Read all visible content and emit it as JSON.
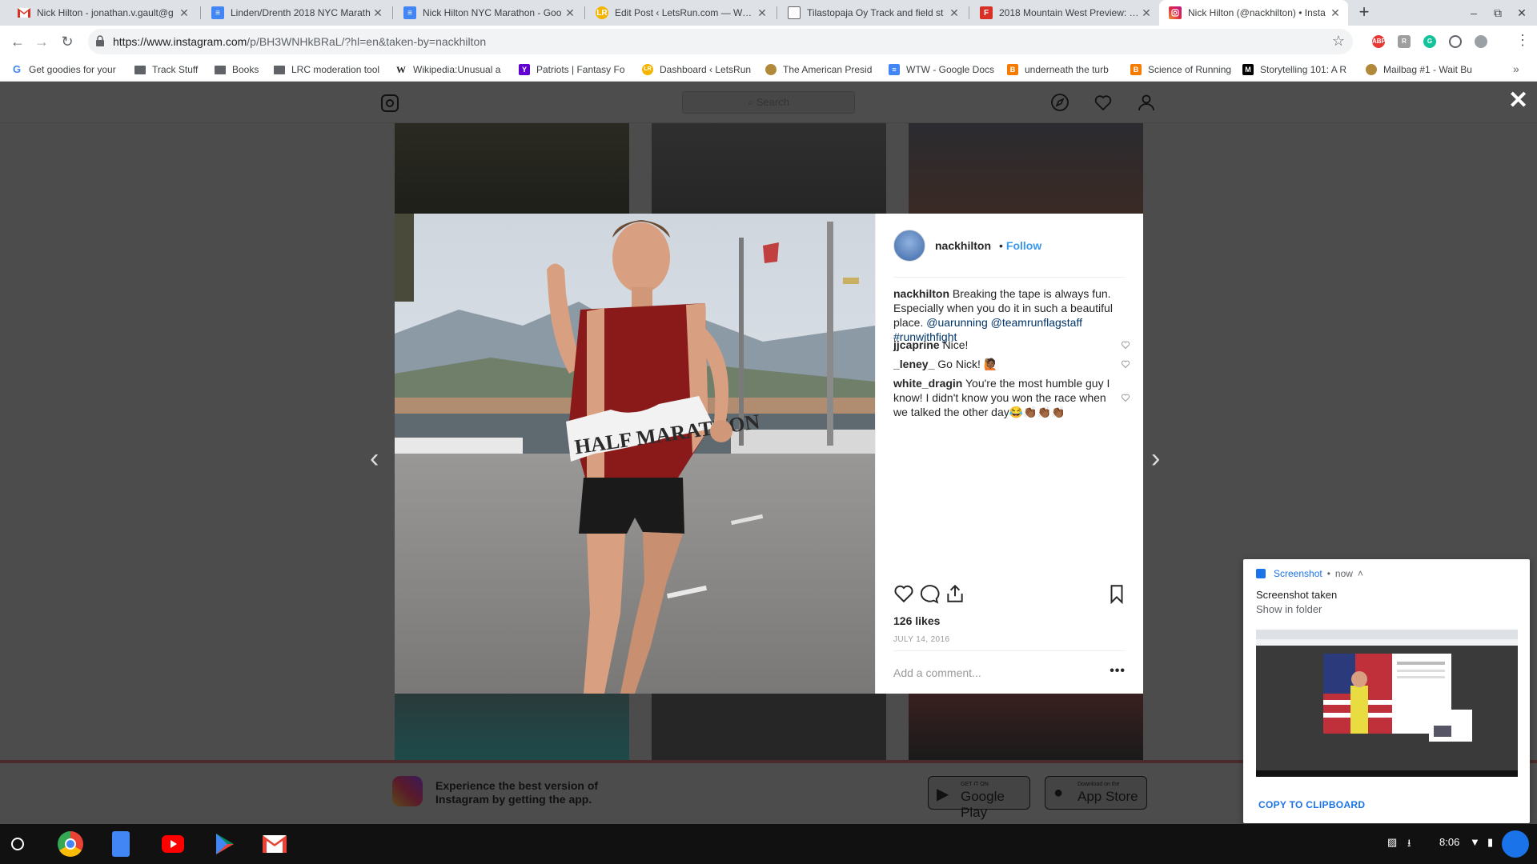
{
  "browser": {
    "tabs": [
      {
        "title": "Nick Hilton - jonathan.v.gault@g",
        "favicon": "gmail",
        "color": "#d93025"
      },
      {
        "title": "Linden/Drenth 2018 NYC Marath",
        "favicon": "docs",
        "color": "#4285f4"
      },
      {
        "title": "Nick Hilton NYC Marathon - Goo",
        "favicon": "docs",
        "color": "#4285f4"
      },
      {
        "title": "Edit Post ‹ LetsRun.com — Word",
        "favicon": "letsrun",
        "color": "#f4b400"
      },
      {
        "title": "Tilastopaja Oy Track and field st",
        "favicon": "page",
        "color": "#9aa0a6"
      },
      {
        "title": "2018 Mountain West Preview: Bo",
        "favicon": "flotrack",
        "color": "#d93025"
      },
      {
        "title": "Nick Hilton (@nackhilton) • Insta",
        "favicon": "instagram",
        "color": "#c13584",
        "active": true
      }
    ],
    "url_main": "https://www.instagram.com",
    "url_rest": "/p/BH3WNHkBRaL/?hl=en&taken-by=nackhilton",
    "bookmarks": [
      {
        "label": "Get goodies for your",
        "icon": "google",
        "color": "#4285f4"
      },
      {
        "label": "Track Stuff",
        "icon": "folder"
      },
      {
        "label": "Books",
        "icon": "folder"
      },
      {
        "label": "LRC moderation tool",
        "icon": "folder"
      },
      {
        "label": "Wikipedia:Unusual a",
        "icon": "wikipedia",
        "color": "#202124"
      },
      {
        "label": "Patriots | Fantasy Fo",
        "icon": "yahoo",
        "color": "#6001d2"
      },
      {
        "label": "Dashboard ‹ LetsRun",
        "icon": "letsrun",
        "color": "#f4b400"
      },
      {
        "label": "The American Presid",
        "icon": "seal",
        "color": "#b08a3a"
      },
      {
        "label": "WTW - Google Docs",
        "icon": "docs",
        "color": "#4285f4"
      },
      {
        "label": "underneath the turb",
        "icon": "blogger",
        "color": "#f57c00"
      },
      {
        "label": "Science of Running",
        "icon": "blogger",
        "color": "#f57c00"
      },
      {
        "label": "Storytelling 101: A R",
        "icon": "medium",
        "color": "#000000"
      },
      {
        "label": "Mailbag #1 - Wait Bu",
        "icon": "seal",
        "color": "#b08a3a"
      }
    ],
    "extensions": [
      {
        "name": "adblock-plus-icon",
        "label": "ABP",
        "color": "#e53935"
      },
      {
        "name": "extension-r-icon",
        "label": "R",
        "color": "#9e9e9e"
      },
      {
        "name": "grammarly-icon",
        "label": "G",
        "color": "#15c39a"
      },
      {
        "name": "extension-settings-icon",
        "label": "",
        "color": "#5f6368"
      },
      {
        "name": "profile-icon",
        "label": "",
        "color": "#9aa0a6"
      }
    ]
  },
  "instagram": {
    "search_placeholder": "Search",
    "post": {
      "username": "nackhilton",
      "follow_label": "Follow",
      "caption_user": "nackhilton",
      "caption_text": "Breaking the tape is always fun. Especially when you do it in such a beautiful place.",
      "caption_mentions": "@uarunning @teamrunflagstaff",
      "caption_hashtag": "#runwithfight",
      "comments": [
        {
          "user": "jjcaprine",
          "text": "Nice!"
        },
        {
          "user": "_leney_",
          "text": "Go Nick! 🙋🏾"
        },
        {
          "user": "white_dragin",
          "text": "You're the most humble guy I know! I didn't know you won the race when we talked the other day😂👏🏾👏🏾👏🏾"
        }
      ],
      "likes": "126 likes",
      "date": "JULY 14, 2016",
      "comment_placeholder": "Add a comment...",
      "more_label": "•••",
      "bib_text": "HALF MARATHON"
    },
    "app_banner": {
      "text": "Experience the best version of Instagram by getting the app.",
      "google_small": "GET IT ON",
      "google_big": "Google Play",
      "apple_small": "Download on the",
      "apple_big": "App Store"
    }
  },
  "notification": {
    "app": "Screenshot",
    "time": "now",
    "title": "Screenshot taken",
    "subtitle": "Show in folder",
    "action": "COPY TO CLIPBOARD"
  },
  "shelf": {
    "time": "8:06",
    "apps": [
      {
        "name": "chrome-app",
        "color": "#34a853"
      },
      {
        "name": "docs-app",
        "color": "#4285f4"
      },
      {
        "name": "youtube-app",
        "color": "#ff0000"
      },
      {
        "name": "play-store-app",
        "color": "#01875f"
      },
      {
        "name": "gmail-app",
        "color": "#ea4335"
      }
    ]
  }
}
